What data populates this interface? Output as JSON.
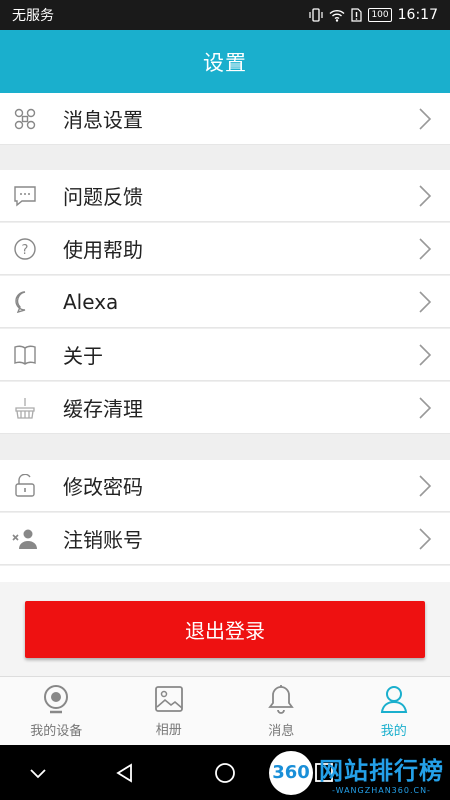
{
  "status_bar": {
    "carrier": "无服务",
    "battery": "100",
    "time": "16:17"
  },
  "header": {
    "title": "设置"
  },
  "menu": {
    "message_settings": "消息设置",
    "feedback": "问题反馈",
    "help": "使用帮助",
    "alexa": "Alexa",
    "about": "关于",
    "clear_cache": "缓存清理",
    "change_password": "修改密码",
    "cancel_account": "注销账号"
  },
  "logout_label": "退出登录",
  "bottom_nav": [
    {
      "label": "我的设备",
      "icon": "camera-icon",
      "active": false
    },
    {
      "label": "相册",
      "icon": "album-icon",
      "active": false
    },
    {
      "label": "消息",
      "icon": "bell-icon",
      "active": false
    },
    {
      "label": "我的",
      "icon": "user-icon",
      "active": true
    }
  ],
  "watermark": {
    "logo": "360",
    "title": "网站排行榜",
    "subtitle": "-WANGZHAN360.CN-"
  },
  "colors": {
    "accent": "#1aafcd",
    "logout": "#ee1111"
  }
}
